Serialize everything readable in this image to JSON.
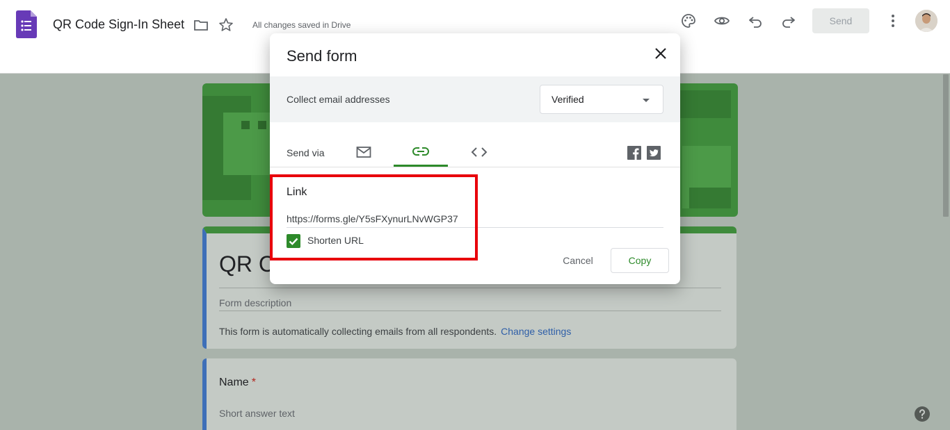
{
  "header": {
    "app_icon": "google-forms-icon",
    "doc_title": "QR Code Sign-In Sheet",
    "save_status": "All changes saved in Drive",
    "send_label": "Send",
    "icons": [
      "folder-icon",
      "star-icon",
      "palette-icon",
      "eye-icon",
      "undo-icon",
      "redo-icon",
      "more-vert-icon",
      "avatar"
    ]
  },
  "form": {
    "title_visible": "QR Co",
    "description_placeholder": "Form description",
    "collect_note": "This form is automatically collecting emails from all respondents.",
    "change_settings_label": "Change settings",
    "question": {
      "title": "Name",
      "required_mark": "*",
      "hint": "Short answer text"
    }
  },
  "dialog": {
    "title": "Send form",
    "collect_label": "Collect email addresses",
    "collect_value": "Verified",
    "send_via_label": "Send via",
    "tabs": [
      "email-icon",
      "link-icon",
      "embed-icon"
    ],
    "active_tab": "link",
    "social": [
      "facebook-icon",
      "twitter-icon"
    ],
    "link_heading": "Link",
    "link_url": "https://forms.gle/Y5sFXynurLNvWGP37",
    "shorten_label": "Shorten URL",
    "shorten_checked": true,
    "cancel_label": "Cancel",
    "copy_label": "Copy"
  },
  "colors": {
    "accent_green": "#2d8a2a",
    "banner_green": "#3f8b3c",
    "forms_purple": "#673ab7",
    "highlight_red": "#e8000b",
    "link_blue": "#2f5fa8"
  }
}
